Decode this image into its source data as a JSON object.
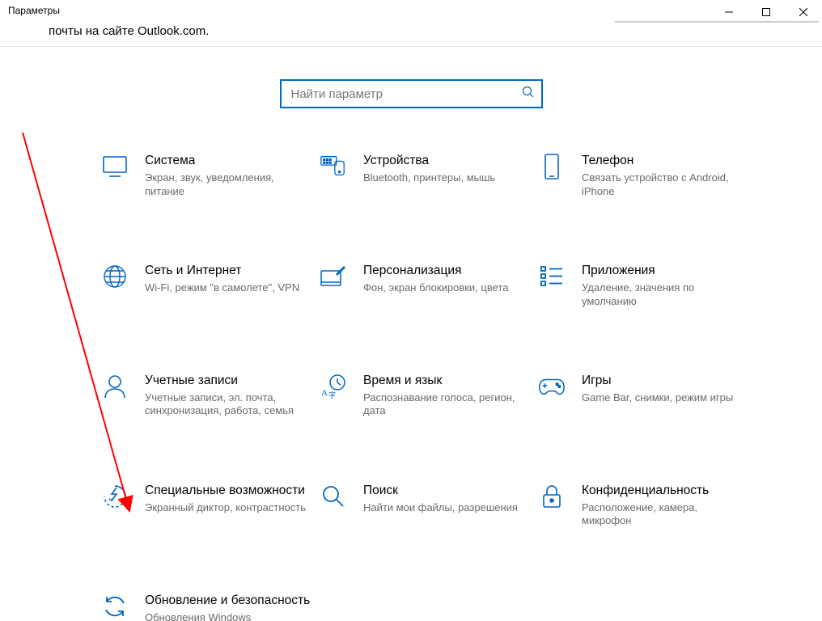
{
  "window": {
    "title": "Параметры"
  },
  "subtitle": "почты на сайте Outlook.com.",
  "search": {
    "placeholder": "Найти параметр"
  },
  "tiles": [
    {
      "title": "Система",
      "desc": "Экран, звук, уведомления, питание"
    },
    {
      "title": "Устройства",
      "desc": "Bluetooth, принтеры, мышь"
    },
    {
      "title": "Телефон",
      "desc": "Связать устройство с Android, iPhone"
    },
    {
      "title": "Сеть и Интернет",
      "desc": "Wi-Fi, режим \"в самолете\", VPN"
    },
    {
      "title": "Персонализация",
      "desc": "Фон, экран блокировки, цвета"
    },
    {
      "title": "Приложения",
      "desc": "Удаление, значения по умолчанию"
    },
    {
      "title": "Учетные записи",
      "desc": "Учетные записи, эл. почта, синхронизация, работа, семья"
    },
    {
      "title": "Время и язык",
      "desc": "Распознавание голоса, регион, дата"
    },
    {
      "title": "Игры",
      "desc": "Game Bar, снимки, режим игры"
    },
    {
      "title": "Специальные возможности",
      "desc": "Экранный диктор, контрастность"
    },
    {
      "title": "Поиск",
      "desc": "Найти мои файлы, разрешения"
    },
    {
      "title": "Конфиденциальность",
      "desc": "Расположение, камера, микрофон"
    },
    {
      "title": "Обновление и безопасность",
      "desc": "Обновления Windows"
    }
  ],
  "colors": {
    "accent": "#0067c0",
    "muted": "#6a6a6a",
    "arrow": "#ff0000"
  }
}
